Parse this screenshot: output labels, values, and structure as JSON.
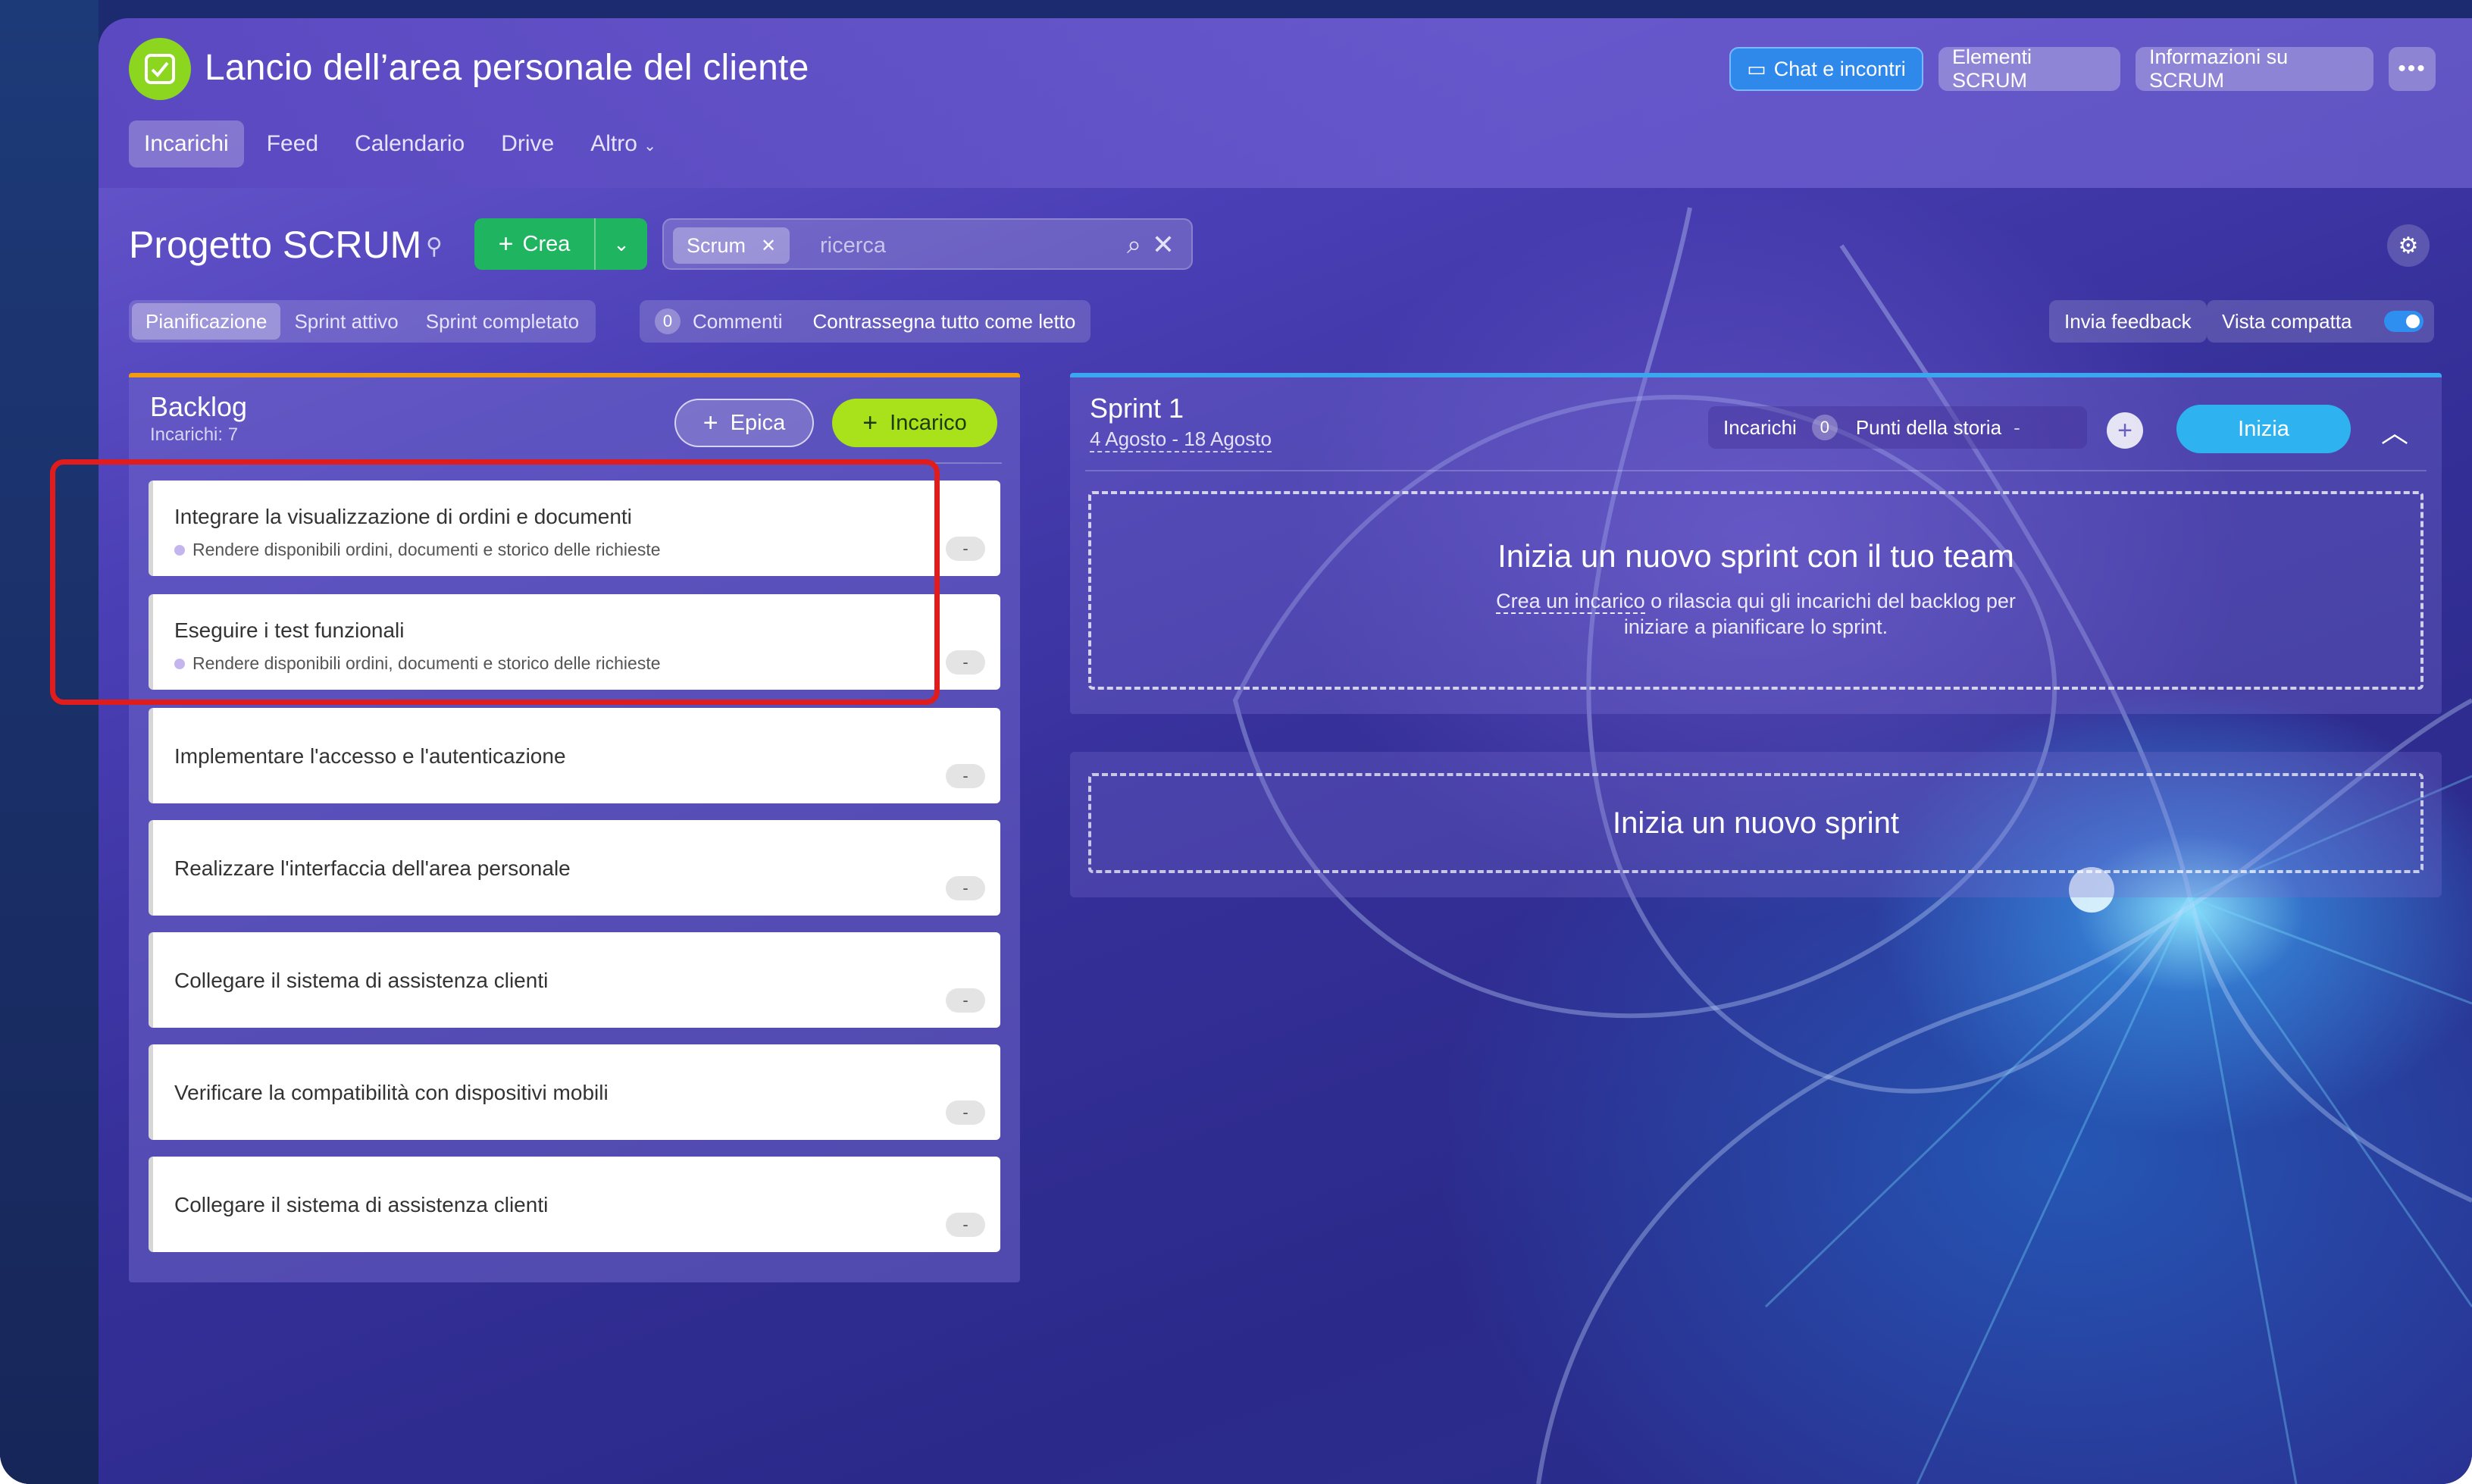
{
  "header": {
    "title": "Lancio dell’area personale del cliente",
    "buttons": {
      "chat": "Chat e incontri",
      "elements": "Elementi SCRUM",
      "info": "Informazioni su SCRUM",
      "more": "•••"
    },
    "tabs": [
      "Incarichi",
      "Feed",
      "Calendario",
      "Drive",
      "Altro"
    ]
  },
  "project": {
    "title": "Progetto SCRUM",
    "create_label": "Crea",
    "search": {
      "chip": "Scrum",
      "placeholder": "ricerca"
    },
    "subtabs": [
      "Pianificazione",
      "Sprint attivo",
      "Sprint completato"
    ],
    "comments": {
      "count": "0",
      "label": "Commenti",
      "mark_all": "Contrassegna tutto come letto"
    },
    "feedback": "Invia feedback",
    "compact_view": "Vista compatta"
  },
  "backlog": {
    "title": "Backlog",
    "subtitle": "Incarichi: 7",
    "epic_button": "Epica",
    "task_button": "Incarico",
    "tasks": [
      {
        "title": "Integrare la visualizzazione di ordini e documenti",
        "epic": "Rendere disponibili ordini, documenti e storico delle richieste",
        "points": "-"
      },
      {
        "title": "Eseguire i test funzionali",
        "epic": "Rendere disponibili ordini, documenti e storico delle richieste",
        "points": "-"
      },
      {
        "title": "Implementare l'accesso e l'autenticazione",
        "points": "-"
      },
      {
        "title": "Realizzare l'interfaccia dell'area personale",
        "points": "-"
      },
      {
        "title": "Collegare il sistema di assistenza clienti",
        "points": "-"
      },
      {
        "title": "Verificare la compatibilità con dispositivi mobili",
        "points": "-"
      },
      {
        "title": "Collegare il sistema di assistenza clienti",
        "points": "-"
      }
    ]
  },
  "sprint": {
    "title": "Sprint 1",
    "dates": "4 Agosto - 18 Agosto",
    "tasks_label": "Incarichi",
    "tasks_count": "0",
    "story_points_label": "Punti della storia",
    "story_points_value": "-",
    "start_button": "Inizia",
    "empty_title": "Inizia un nuovo sprint con il tuo team",
    "empty_sub_link": "Crea un incarico",
    "empty_sub_rest": " o rilascia qui gli incarichi del backlog per",
    "empty_sub_line2": "iniziare a pianificare lo sprint."
  },
  "new_sprint": {
    "label": "Inizia un nuovo sprint"
  },
  "colors": {
    "accent_green": "#1fb560",
    "lime": "#a9e21b",
    "sky": "#2fb3f0",
    "highlight_red": "#e01c1c",
    "backlog_top": "#f39c12"
  }
}
